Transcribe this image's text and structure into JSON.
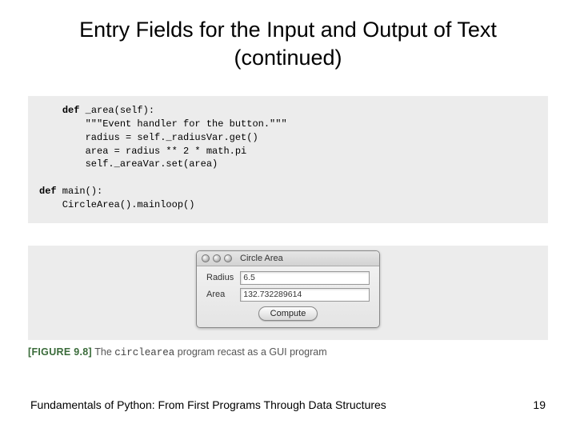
{
  "title": "Entry Fields for the Input and Output of Text (continued)",
  "code": {
    "indent1": "    ",
    "kw_def1": "def",
    "method_sig": " _area(self):",
    "line2": "        \"\"\"Event handler for the button.\"\"\"",
    "line3": "        radius = self._radiusVar.get()",
    "line4": "        area = radius ** 2 * math.pi",
    "line5": "        self._areaVar.set(area)",
    "blank": "",
    "kw_def2": "def",
    "main_sig": " main():",
    "line8": "    CircleArea().mainloop()"
  },
  "gui": {
    "window_title": "Circle Area",
    "radius_label": "Radius",
    "radius_value": "6.5",
    "area_label": "Area",
    "area_value": "132.732289614",
    "compute_label": "Compute"
  },
  "figure": {
    "label": "[FIGURE 9.8]",
    "pre_code_text": " The ",
    "code_word": "circlearea",
    "post_code_text": " program recast as a GUI program"
  },
  "footer": {
    "text": "Fundamentals of Python: From First Programs Through Data Structures",
    "page": "19"
  }
}
